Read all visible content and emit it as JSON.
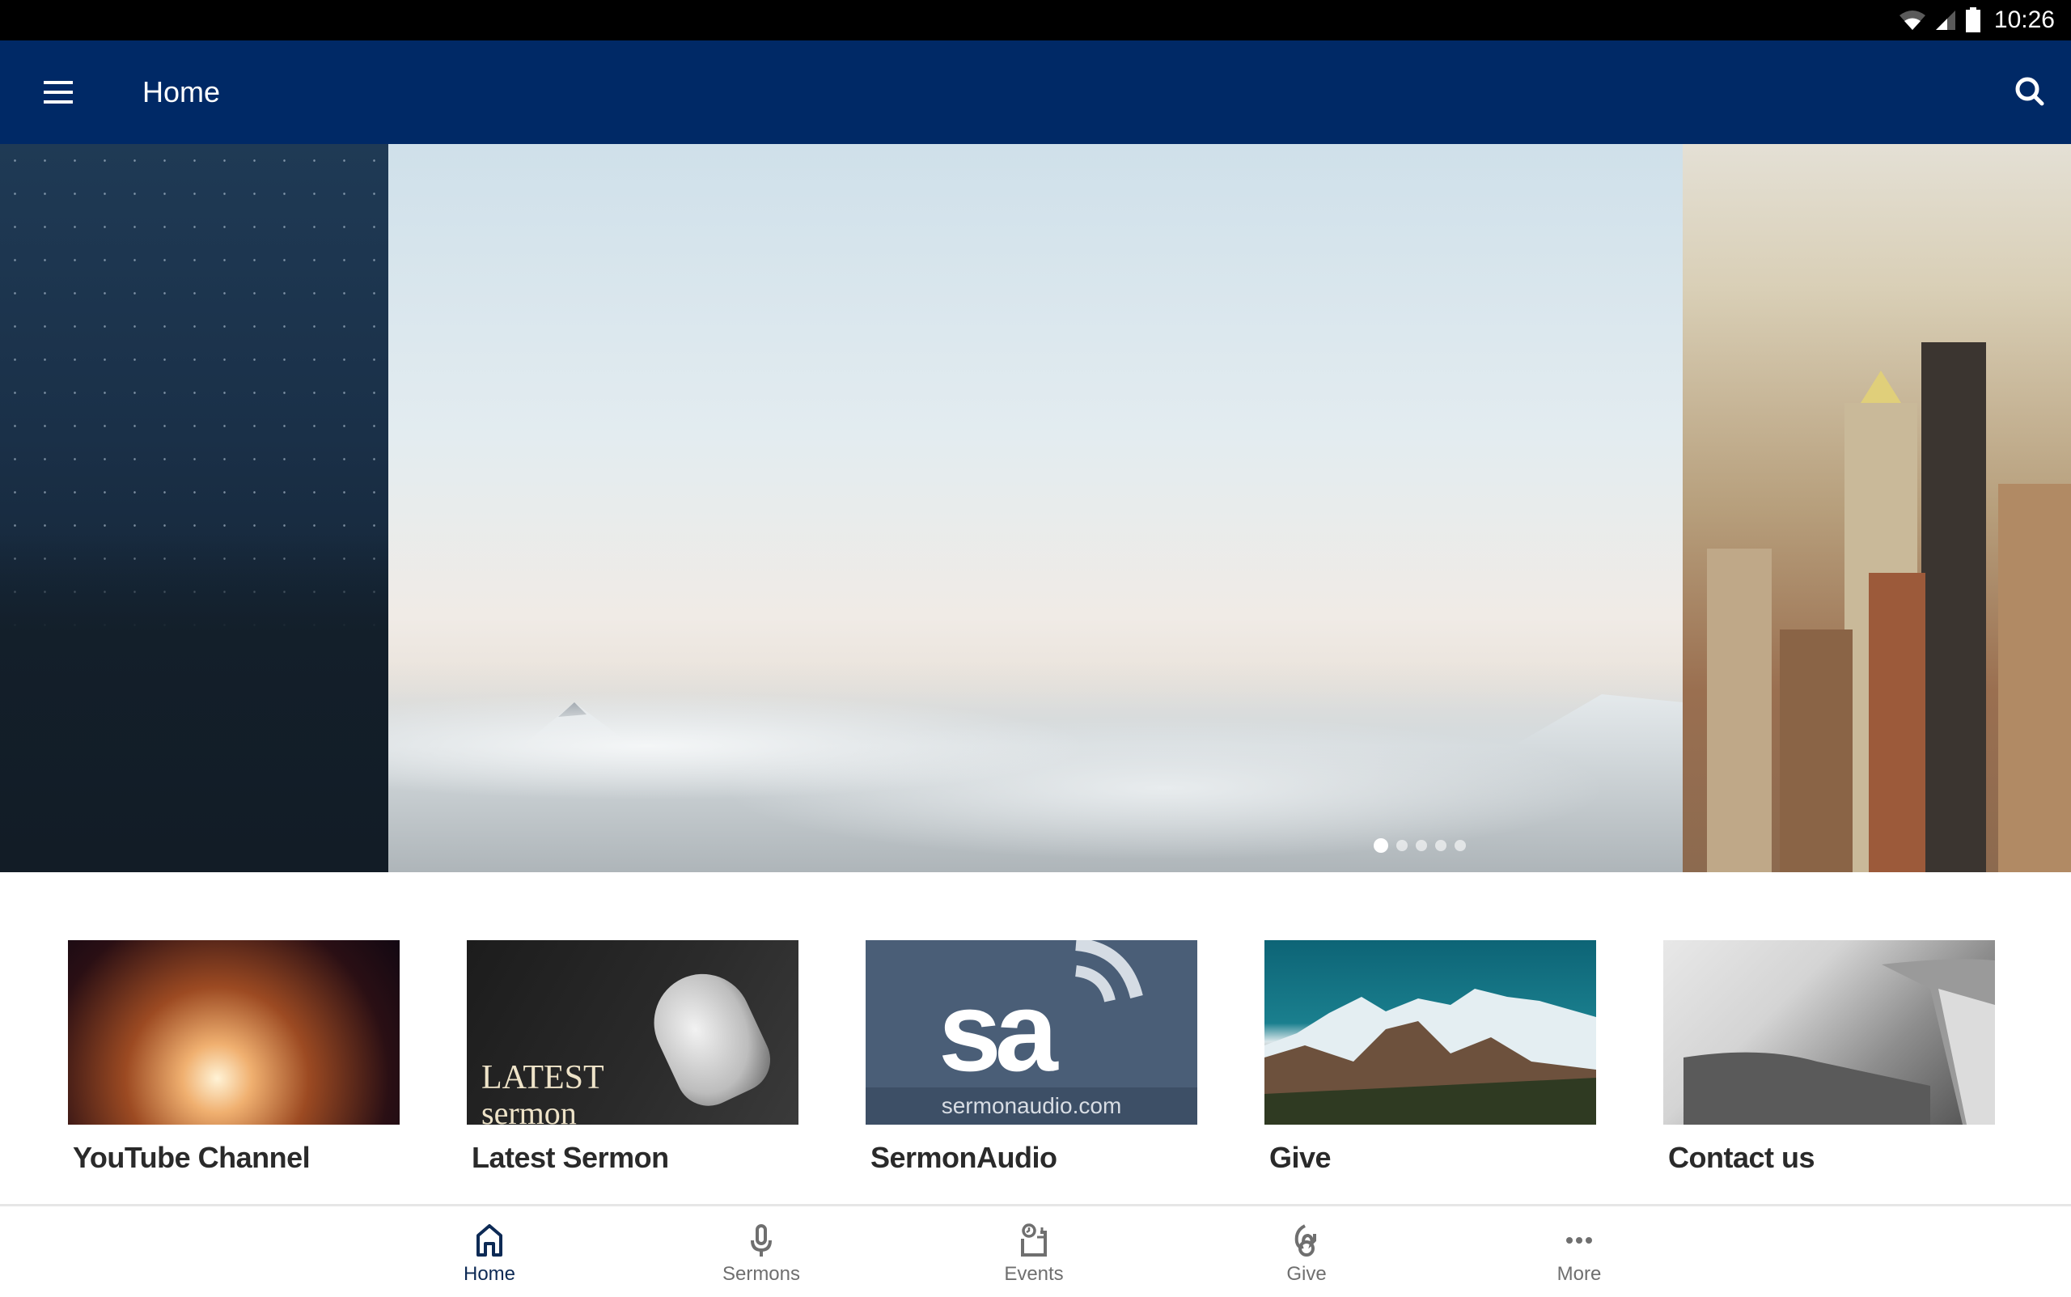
{
  "status_bar": {
    "time": "10:26",
    "icons": [
      "wifi-icon",
      "cell-signal-icon",
      "battery-icon"
    ]
  },
  "app_bar": {
    "title": "Home",
    "menu_icon": "hamburger-menu-icon",
    "search_icon": "search-icon",
    "background_color": "#002966"
  },
  "carousel": {
    "slides": [
      {
        "name": "night-sky-forest"
      },
      {
        "name": "clouds-mountains"
      },
      {
        "name": "city-skyline"
      }
    ],
    "page_count": 5,
    "active_page": 1
  },
  "tiles": [
    {
      "label": "YouTube Channel",
      "image": "night-road-lights"
    },
    {
      "label": "Latest Sermon",
      "image": "bible-headphones",
      "image_text": [
        "LATEST",
        "sermon"
      ]
    },
    {
      "label": "SermonAudio",
      "image": "sermonaudio-logo",
      "image_text": [
        "sa",
        "sermonaudio.com"
      ]
    },
    {
      "label": "Give",
      "image": "snowy-mountains"
    },
    {
      "label": "Contact us",
      "image": "modern-architecture"
    }
  ],
  "bottom_nav": {
    "items": [
      {
        "label": "Home",
        "icon": "home-icon",
        "active": true
      },
      {
        "label": "Sermons",
        "icon": "microphone-icon",
        "active": false
      },
      {
        "label": "Events",
        "icon": "calendar-clock-icon",
        "active": false
      },
      {
        "label": "Give",
        "icon": "give-hand-icon",
        "active": false
      },
      {
        "label": "More",
        "icon": "more-dots-icon",
        "active": false
      }
    ],
    "active_color": "#0d2a55",
    "inactive_color": "#6f6f6f"
  }
}
